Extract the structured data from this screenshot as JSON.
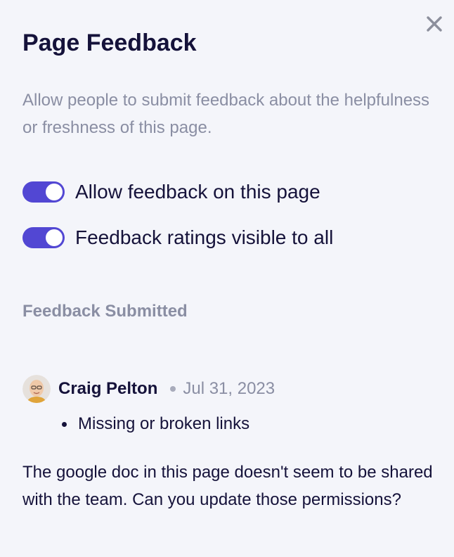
{
  "panel": {
    "title": "Page Feedback",
    "description": "Allow people to submit feedback about the helpfulness or freshness of this page.",
    "close_icon": "close-icon"
  },
  "toggles": [
    {
      "label": "Allow feedback on this page",
      "enabled": true
    },
    {
      "label": "Feedback ratings visible to all",
      "enabled": true
    }
  ],
  "feedback": {
    "heading": "Feedback Submitted",
    "entries": [
      {
        "author": "Craig Pelton",
        "date": "Jul 31, 2023",
        "reasons": [
          "Missing or broken links"
        ],
        "comment": "The google doc in this page doesn't seem to be shared with the team. Can you update those permissions?"
      }
    ]
  },
  "colors": {
    "accent": "#5247d3",
    "background": "#f4f5fa",
    "text": "#15123a",
    "muted": "#8a8ea3"
  }
}
